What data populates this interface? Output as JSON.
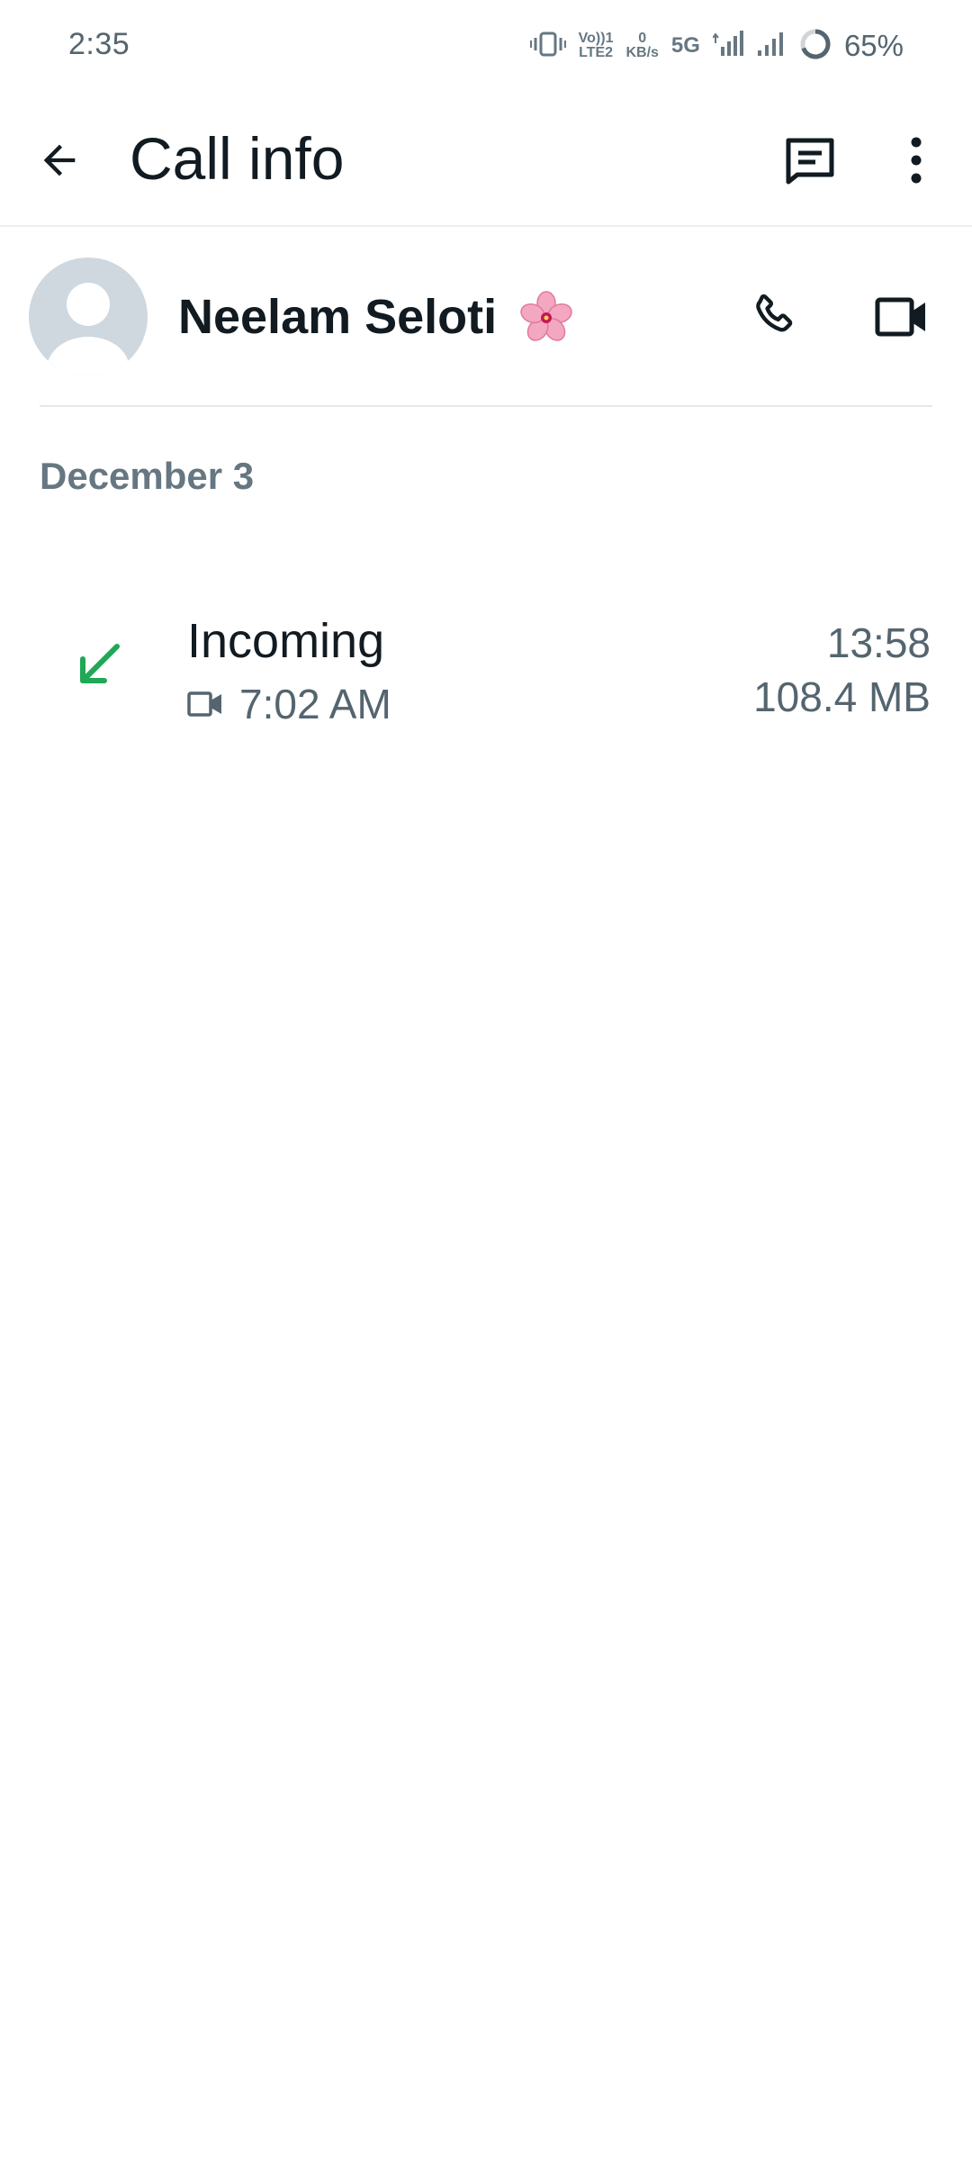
{
  "status_bar": {
    "time": "2:35",
    "volte_top": "Vo))1",
    "volte_bottom": "LTE2",
    "data_rate_top": "0",
    "data_rate_bottom": "KB/s",
    "network": "5G",
    "battery": "65%",
    "battery_level": 0.65,
    "icons": [
      "vibrate-icon",
      "signal-icon",
      "battery-icon"
    ]
  },
  "app_bar": {
    "title": "Call info",
    "icons": [
      "back-arrow-icon",
      "message-icon",
      "more-vert-icon"
    ]
  },
  "contact": {
    "name": "Neelam Seloti",
    "emoji": "cherry-blossom-icon",
    "actions": [
      "phone-icon",
      "videocam-icon"
    ]
  },
  "date_header": "December 3",
  "calls": [
    {
      "direction": "Incoming",
      "direction_icon": "incoming-arrow-icon",
      "media_icon": "videocam-icon",
      "time": "7:02 AM",
      "duration": "13:58",
      "data_used": "108.4 MB"
    }
  ],
  "colors": {
    "incoming_green": "#1fa855",
    "primary_text": "#111b21",
    "secondary_text": "#54656f",
    "avatar_bg": "#cfd8df"
  }
}
